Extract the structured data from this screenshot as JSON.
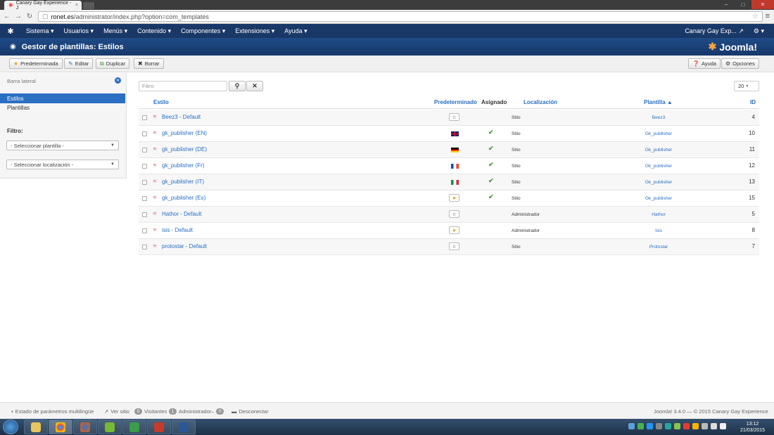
{
  "browser": {
    "tab_title": "Canary Gay Experience - J",
    "url_domain": "ronet.es",
    "url_path": "/administrator/index.php?option=com_templates"
  },
  "nav": {
    "items": [
      "Sistema ▾",
      "Usuarios ▾",
      "Menús ▾",
      "Contenido ▾",
      "Componentes ▾",
      "Extensiones ▾",
      "Ayuda ▾"
    ],
    "site_name": "Canary Gay Exp...",
    "gear": "⚙ ▾"
  },
  "header": {
    "title": "Gestor de plantillas: Estilos",
    "brand": "Joomla!"
  },
  "toolbar": {
    "default_label": "Predeterminada",
    "edit_label": "Editar",
    "duplicate_label": "Duplicar",
    "delete_label": "Borrar",
    "help_label": "Ayuda",
    "options_label": "Opciones"
  },
  "sidebar": {
    "title": "Barra lateral",
    "items": [
      "Estilos",
      "Plantillas"
    ],
    "filter_label": "Filtro:",
    "select_template": "- Seleccionar plantilla -",
    "select_location": "- Seleccionar localización -"
  },
  "search": {
    "placeholder": "Filtro",
    "limit": "20"
  },
  "table": {
    "headers": {
      "style": "Estilo",
      "default": "Predeterminado",
      "assigned": "Asignado",
      "location": "Localización",
      "template": "Plantilla ▲",
      "id": "ID"
    },
    "rows": [
      {
        "name": "Beez3 - Default",
        "default": "star-off",
        "assigned": false,
        "location": "Sitio",
        "template": "Beez3",
        "id": "4"
      },
      {
        "name": "gk_publisher (EN)",
        "default": "flag-gb",
        "assigned": true,
        "location": "Sitio",
        "template": "Gk_publisher",
        "id": "10"
      },
      {
        "name": "gk_publisher (DE)",
        "default": "flag-de",
        "assigned": true,
        "location": "Sitio",
        "template": "Gk_publisher",
        "id": "11"
      },
      {
        "name": "gk_publisher (Fr)",
        "default": "flag-fr",
        "assigned": true,
        "location": "Sitio",
        "template": "Gk_publisher",
        "id": "12"
      },
      {
        "name": "gk_publisher (IT)",
        "default": "flag-it",
        "assigned": true,
        "location": "Sitio",
        "template": "Gk_publisher",
        "id": "13"
      },
      {
        "name": "gk_publisher (Es)",
        "default": "star-on",
        "assigned": true,
        "location": "Sitio",
        "template": "Gk_publisher",
        "id": "15"
      },
      {
        "name": "Hathor - Default",
        "default": "star-off",
        "assigned": false,
        "location": "Administrador",
        "template": "Hathor",
        "id": "5"
      },
      {
        "name": "isis - Default",
        "default": "star-on",
        "assigned": false,
        "location": "Administrador",
        "template": "Isis",
        "id": "8"
      },
      {
        "name": "protostar - Default",
        "default": "star-off",
        "assigned": false,
        "location": "Sitio",
        "template": "Protostar",
        "id": "7"
      }
    ]
  },
  "footer": {
    "multilang": "Estado de parámetros multilingüe",
    "view_site": "Ver sitio",
    "visitors_count": "0",
    "visitors_label": "Visitantes",
    "admins_count": "1",
    "admins_label": "Administrador",
    "messages_count": "0",
    "logout": "Desconectar",
    "copyright": "Joomla! 3.4.0 — © 2015 Canary Gay Experience"
  },
  "taskbar": {
    "time": "13:12",
    "date": "21/03/2015"
  },
  "colors": {
    "nav_bg": "#1a3867",
    "header_bg": "#1f4b87",
    "link": "#2a6fc2",
    "check": "#4c9a3a",
    "star_on": "#e8a317"
  }
}
